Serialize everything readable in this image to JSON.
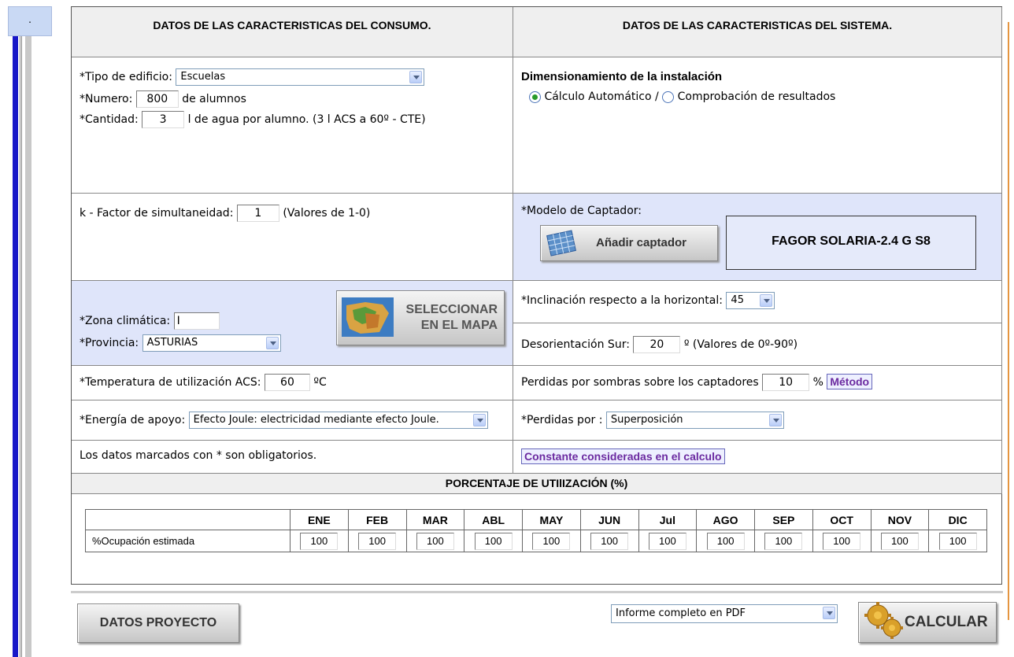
{
  "consumo": {
    "header": "DATOS DE LAS CARACTERISTICAS DEL CONSUMO.",
    "tipo_label": "*Tipo de edificio:",
    "tipo_value": "Escuelas",
    "numero_label": "*Numero:",
    "numero_value": "800",
    "numero_unit": "de alumnos",
    "cantidad_label": "*Cantidad:",
    "cantidad_value": "3",
    "cantidad_unit": "l de agua por alumno. (3 l ACS a 60º - CTE)",
    "k_label": "k - Factor de simultaneidad:",
    "k_value": "1",
    "k_hint": "(Valores de 1-0)",
    "zona_label": "*Zona climática:",
    "zona_value": "I",
    "provincia_label": "*Provincia:",
    "provincia_value": "ASTURIAS",
    "mapa_button_line1": "SELECCIONAR",
    "mapa_button_line2": "EN EL MAPA",
    "temp_label": "*Temperatura de utilización ACS:",
    "temp_value": "60",
    "temp_unit": "ºC",
    "energia_label": "*Energía de apoyo:",
    "energia_value": "Efecto Joule: electricidad mediante efecto Joule.",
    "obligatorios_note": "Los datos marcados con * son obligatorios."
  },
  "sistema": {
    "header": "DATOS DE LAS CARACTERISTICAS DEL SISTEMA.",
    "dim_title": "Dimensionamiento de la instalación",
    "radio_auto": "Cálculo Automático /",
    "radio_check": "Comprobación de resultados",
    "modelo_label": "*Modelo de Captador:",
    "add_button": "Añadir captador",
    "modelo_value": "FAGOR SOLARIA-2.4 G S8",
    "incl_label": "*Inclinación respecto a la horizontal:",
    "incl_value": "45",
    "desor_label": "Desorientación Sur:",
    "desor_value": "20",
    "desor_hint": "º (Valores de 0º-90º)",
    "sombras_label": "Perdidas por sombras sobre los captadores",
    "sombras_value": "10",
    "sombras_unit": "%",
    "metodo_link": "Método",
    "perdidas_label": "*Perdidas por :",
    "perdidas_value": "Superposición",
    "constantes_link": "Constante consideradas en el calculo"
  },
  "porcentaje": {
    "header": "PORCENTAJE DE UTIlIZACIÓN (%)",
    "row_label": "%Ocupación estimada",
    "months": [
      "ENE",
      "FEB",
      "MAR",
      "ABL",
      "MAY",
      "JUN",
      "Jul",
      "AGO",
      "SEP",
      "OCT",
      "NOV",
      "DIC"
    ],
    "values": [
      "100",
      "100",
      "100",
      "100",
      "100",
      "100",
      "100",
      "100",
      "100",
      "100",
      "100",
      "100"
    ]
  },
  "footer": {
    "datos_button": "DATOS PROYECTO",
    "informe_value": "Informe completo en PDF",
    "calcular_button": "CALCULAR"
  },
  "side_tab": "."
}
